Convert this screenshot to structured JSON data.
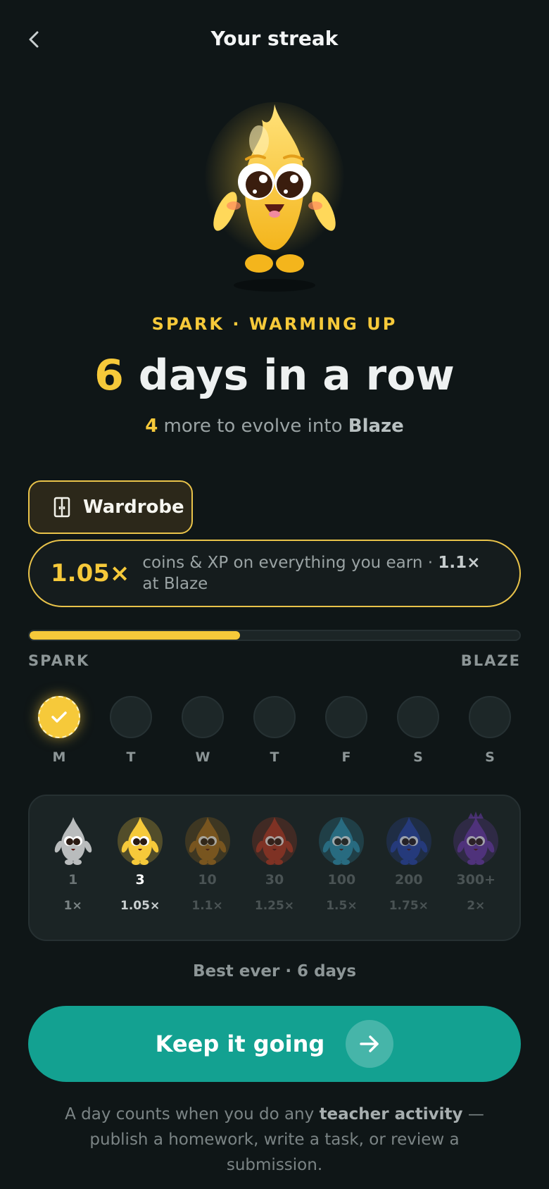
{
  "header": {
    "title": "Your streak",
    "back_icon": "chevron-left-icon"
  },
  "mascot": {
    "name": "spark-mascot",
    "color": "#f6c93a"
  },
  "level": {
    "tag": "SPARK · WARMING UP"
  },
  "streak": {
    "count": "6",
    "label": " days in a row"
  },
  "evolve": {
    "count": "4",
    "prefix": " more to evolve into ",
    "target": "Blaze"
  },
  "wardrobe": {
    "label": "Wardrobe",
    "icon": "wardrobe-icon"
  },
  "multiplier": {
    "value": "1.05×",
    "desc_prefix": "coins & XP on everything you earn · ",
    "next_value": "1.1×",
    "desc_suffix": " at Blaze"
  },
  "progress": {
    "fraction": 0.43,
    "start_label": "SPARK",
    "end_label": "BLAZE"
  },
  "week": [
    {
      "label": "M",
      "done": true
    },
    {
      "label": "T",
      "done": false
    },
    {
      "label": "W",
      "done": false
    },
    {
      "label": "T",
      "done": false
    },
    {
      "label": "F",
      "done": false
    },
    {
      "label": "S",
      "done": false
    },
    {
      "label": "S",
      "done": false
    }
  ],
  "evolutions": [
    {
      "days": "1",
      "mult": "1×",
      "color": "#b9bcbd",
      "state": "passed"
    },
    {
      "days": "3",
      "mult": "1.05×",
      "color": "#f6c93a",
      "state": "current"
    },
    {
      "days": "10",
      "mult": "1.1×",
      "color": "#a86f1d",
      "state": "locked"
    },
    {
      "days": "30",
      "mult": "1.25×",
      "color": "#b23a24",
      "state": "locked"
    },
    {
      "days": "100",
      "mult": "1.5×",
      "color": "#2f8fb0",
      "state": "locked"
    },
    {
      "days": "200",
      "mult": "1.75×",
      "color": "#2a46a8",
      "state": "locked"
    },
    {
      "days": "300+",
      "mult": "2×",
      "color": "#6a3aa8",
      "state": "locked"
    }
  ],
  "best": {
    "text": "Best ever · 6 days"
  },
  "cta": {
    "label": "Keep it going",
    "icon": "arrow-right-icon"
  },
  "footnote": {
    "prefix": "A day counts when you do any ",
    "bold": "teacher activity",
    "suffix": " — publish a homework, write a task, or review a submission."
  }
}
